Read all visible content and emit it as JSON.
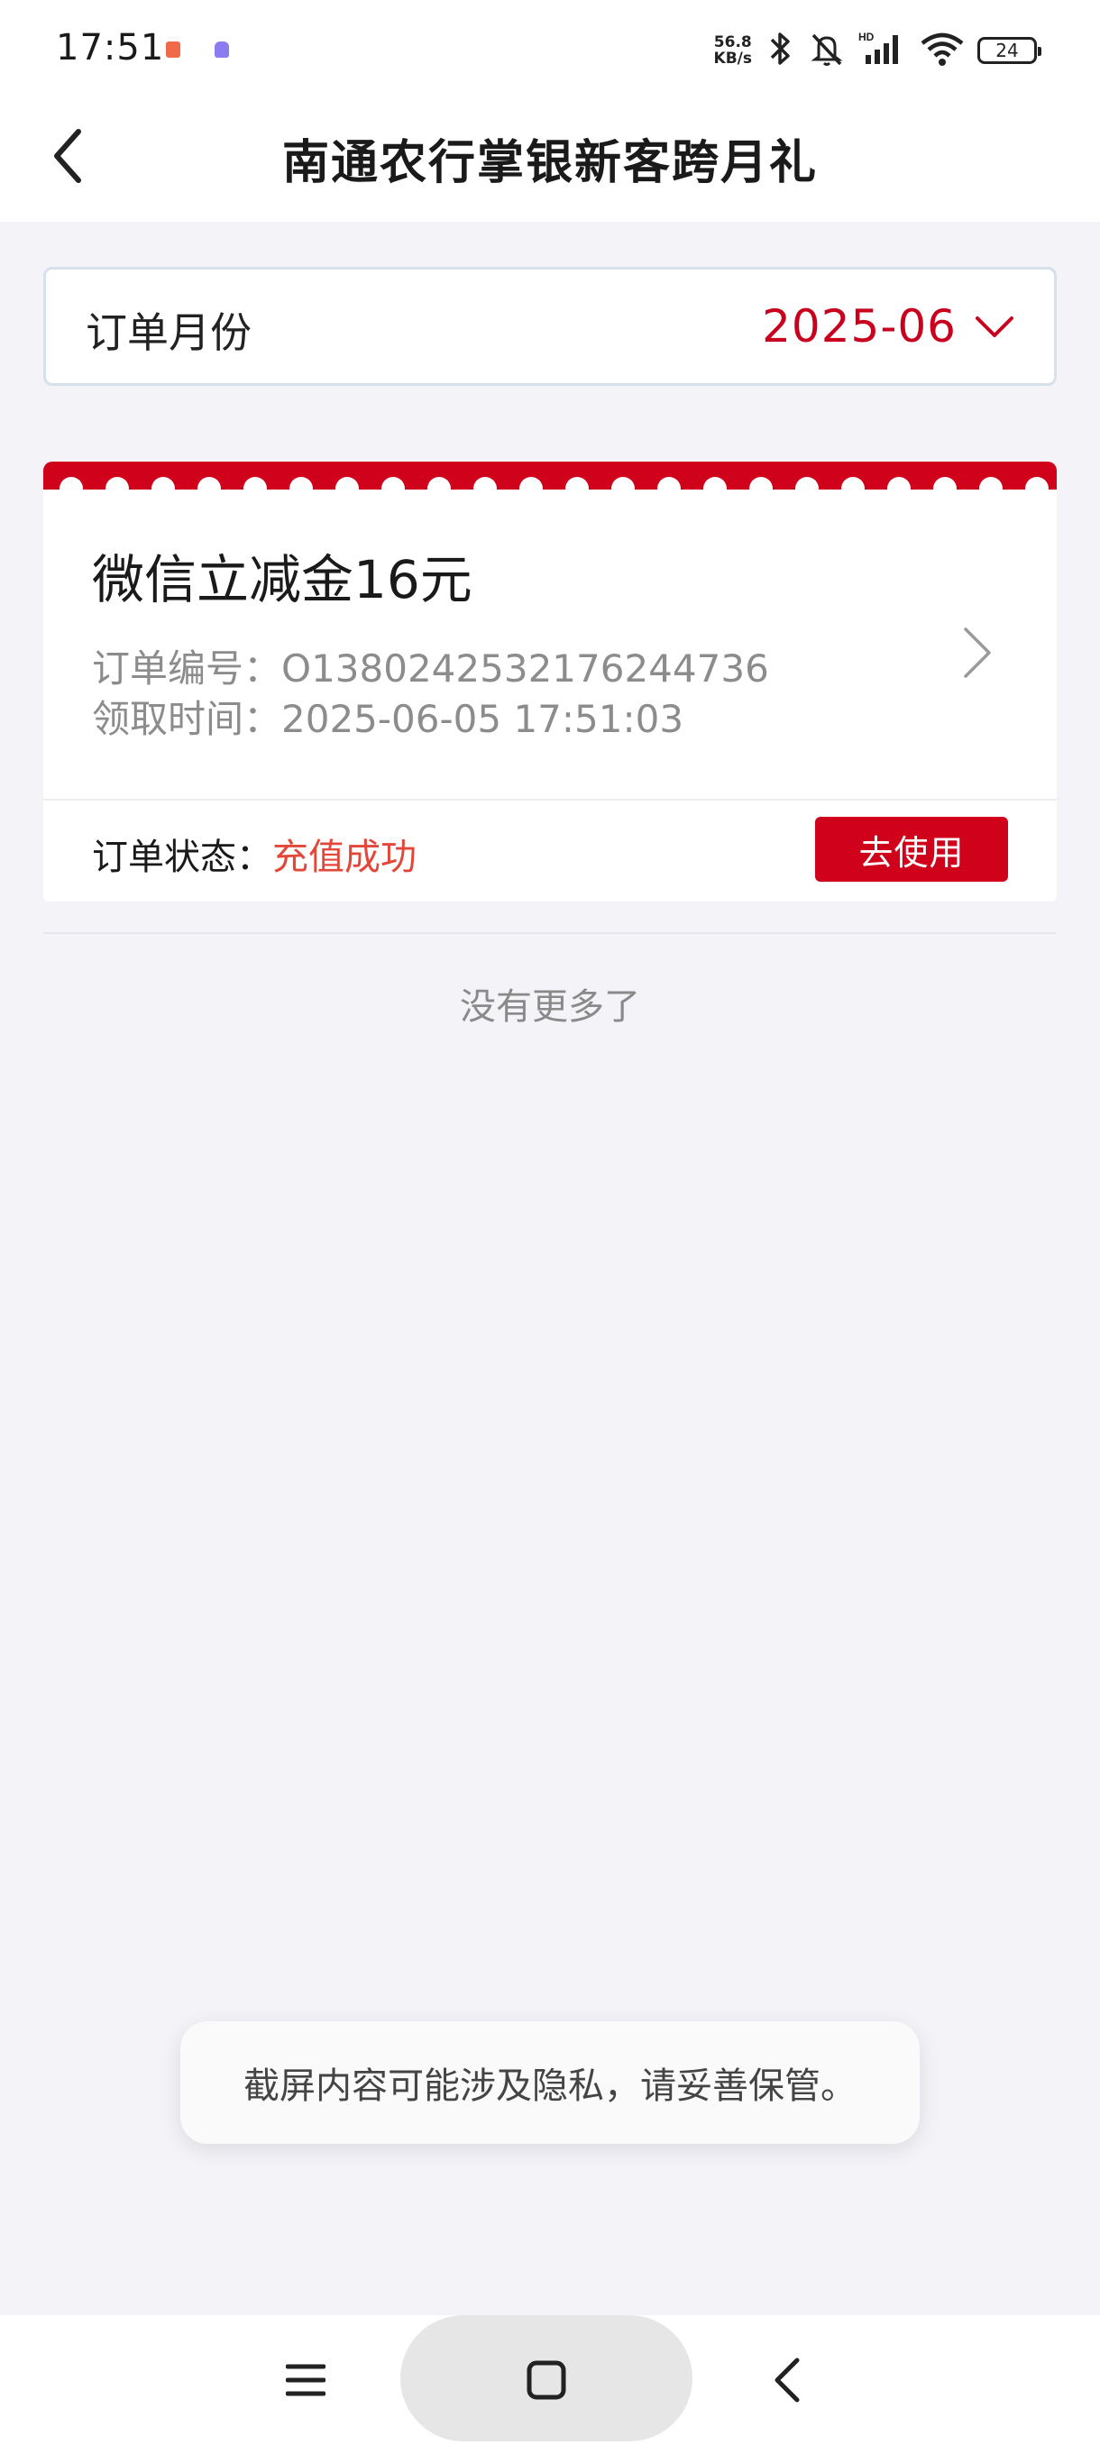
{
  "status_bar": {
    "time": "17:51",
    "net_speed_value": "56.8",
    "net_speed_unit": "KB/s",
    "hd_label": "HD",
    "battery": "24"
  },
  "header": {
    "title": "南通农行掌银新客跨月礼",
    "back_icon": "chevron-left-icon"
  },
  "filter": {
    "label": "订单月份",
    "value": "2025-06",
    "icon": "chevron-down-icon"
  },
  "order": {
    "title": "微信立减金16元",
    "order_no_label": "订单编号：",
    "order_no": "O1380242532176244736",
    "time_label": "领取时间：",
    "time": "2025-06-05 17:51:03",
    "status_label": "订单状态：",
    "status": "充值成功",
    "use_button": "去使用"
  },
  "list_end_text": "没有更多了",
  "toast": "截屏内容可能涉及隐私，请妥善保管。",
  "nav": {
    "menu_icon": "menu-icon",
    "home_icon": "home-square-icon",
    "back_icon": "back-triangle-icon"
  },
  "colors": {
    "brand_red": "#d0021b",
    "month_red": "#c8001e",
    "status_red": "#e2473a",
    "background": "#f3f3f8"
  }
}
